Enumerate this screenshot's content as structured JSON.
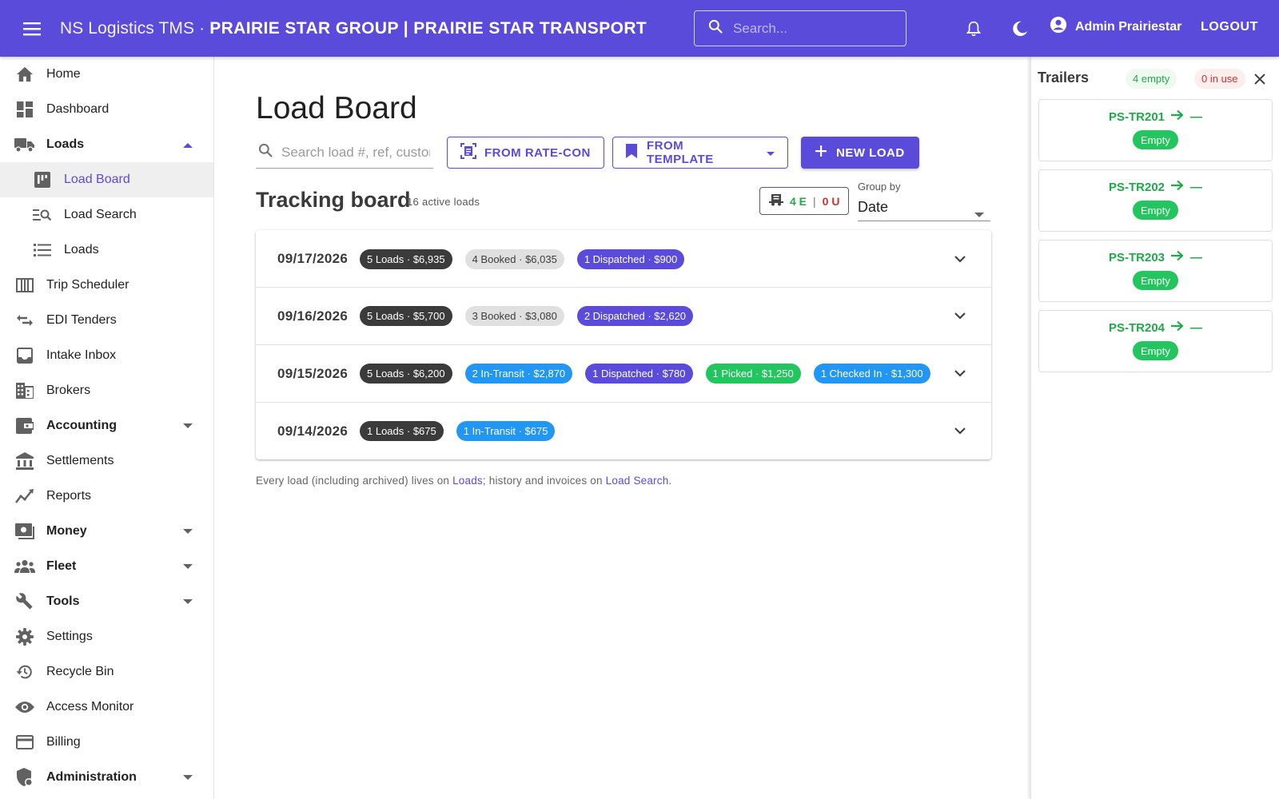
{
  "header": {
    "app_name": "NS Logistics TMS",
    "separator": "·",
    "org_name": "PRAIRIE STAR GROUP | PRAIRIE STAR TRANSPORT",
    "search_placeholder": "Search...",
    "user_name": "Admin Prairiestar",
    "logout_label": "LOGOUT",
    "accent_color": "#5b4bdb",
    "icons": [
      "menu-icon",
      "search-icon",
      "bell-icon",
      "moon-icon",
      "account-circle-icon"
    ]
  },
  "sidebar": {
    "items": [
      {
        "label": "Home",
        "icon": "home-icon"
      },
      {
        "label": "Dashboard",
        "icon": "dashboard-icon"
      },
      {
        "label": "Loads",
        "icon": "truck-icon",
        "expanded": true
      },
      {
        "label": "Load Board",
        "icon": "board-icon",
        "active": true
      },
      {
        "label": "Load Search",
        "icon": "manage-search-icon"
      },
      {
        "label": "Loads",
        "icon": "list-icon"
      },
      {
        "label": "Trip Scheduler",
        "icon": "view-week-icon"
      },
      {
        "label": "EDI Tenders",
        "icon": "swap-icon"
      },
      {
        "label": "Intake Inbox",
        "icon": "inbox-icon"
      },
      {
        "label": "Brokers",
        "icon": "building-icon"
      },
      {
        "label": "Accounting",
        "icon": "wallet-icon",
        "expandable": true
      },
      {
        "label": "Settlements",
        "icon": "bank-icon"
      },
      {
        "label": "Reports",
        "icon": "trend-icon"
      },
      {
        "label": "Money",
        "icon": "money-icon",
        "expandable": true
      },
      {
        "label": "Fleet",
        "icon": "people-icon",
        "expandable": true
      },
      {
        "label": "Tools",
        "icon": "wrench-icon",
        "expandable": true
      },
      {
        "label": "Settings",
        "icon": "gear-icon"
      },
      {
        "label": "Recycle Bin",
        "icon": "history-icon"
      },
      {
        "label": "Access Monitor",
        "icon": "eye-icon"
      },
      {
        "label": "Billing",
        "icon": "credit-card-icon"
      },
      {
        "label": "Administration",
        "icon": "admin-shield-icon",
        "expandable": true
      }
    ]
  },
  "main": {
    "title": "Load Board",
    "search_placeholder": "Search load #, ref, customer",
    "buttons": {
      "rate_con": "FROM RATE-CON",
      "template": "FROM TEMPLATE",
      "new_load": "NEW LOAD"
    },
    "tracking_title": "Tracking board",
    "active_count": "16 active loads",
    "eu": {
      "empty": "4 E",
      "sep": "|",
      "in_use": "0 U"
    },
    "group_by_label": "Group by",
    "group_by_value": "Date",
    "rows": [
      {
        "date": "09/17/2026",
        "chips": [
          {
            "text": "5 Loads · $6,935",
            "kind": "dark"
          },
          {
            "text": "4 Booked · $6,035",
            "kind": "grey"
          },
          {
            "text": "1 Dispatched · $900",
            "kind": "purple"
          }
        ]
      },
      {
        "date": "09/16/2026",
        "chips": [
          {
            "text": "5 Loads · $5,700",
            "kind": "dark"
          },
          {
            "text": "3 Booked · $3,080",
            "kind": "grey"
          },
          {
            "text": "2 Dispatched · $2,620",
            "kind": "purple"
          }
        ]
      },
      {
        "date": "09/15/2026",
        "chips": [
          {
            "text": "5 Loads · $6,200",
            "kind": "dark"
          },
          {
            "text": "2 In-Transit · $2,870",
            "kind": "blue"
          },
          {
            "text": "1 Dispatched · $780",
            "kind": "purple"
          },
          {
            "text": "1 Picked · $1,250",
            "kind": "green"
          },
          {
            "text": "1 Checked In · $1,300",
            "kind": "blue"
          }
        ]
      },
      {
        "date": "09/14/2026",
        "chips": [
          {
            "text": "1 Loads · $675",
            "kind": "dark"
          },
          {
            "text": "1 In-Transit · $675",
            "kind": "blue"
          }
        ]
      }
    ],
    "footnote": {
      "part1": "Every load (including archived) lives on ",
      "link1": "Loads",
      "part2": "; history and invoices on ",
      "link2": "Load Search",
      "part3": "."
    }
  },
  "trailers": {
    "title": "Trailers",
    "empty_badge": "4 empty",
    "in_use_badge": "0 in use",
    "items": [
      {
        "id": "PS-TR201",
        "dest": "—",
        "status": "Empty"
      },
      {
        "id": "PS-TR202",
        "dest": "—",
        "status": "Empty"
      },
      {
        "id": "PS-TR203",
        "dest": "—",
        "status": "Empty"
      },
      {
        "id": "PS-TR204",
        "dest": "—",
        "status": "Empty"
      }
    ]
  }
}
